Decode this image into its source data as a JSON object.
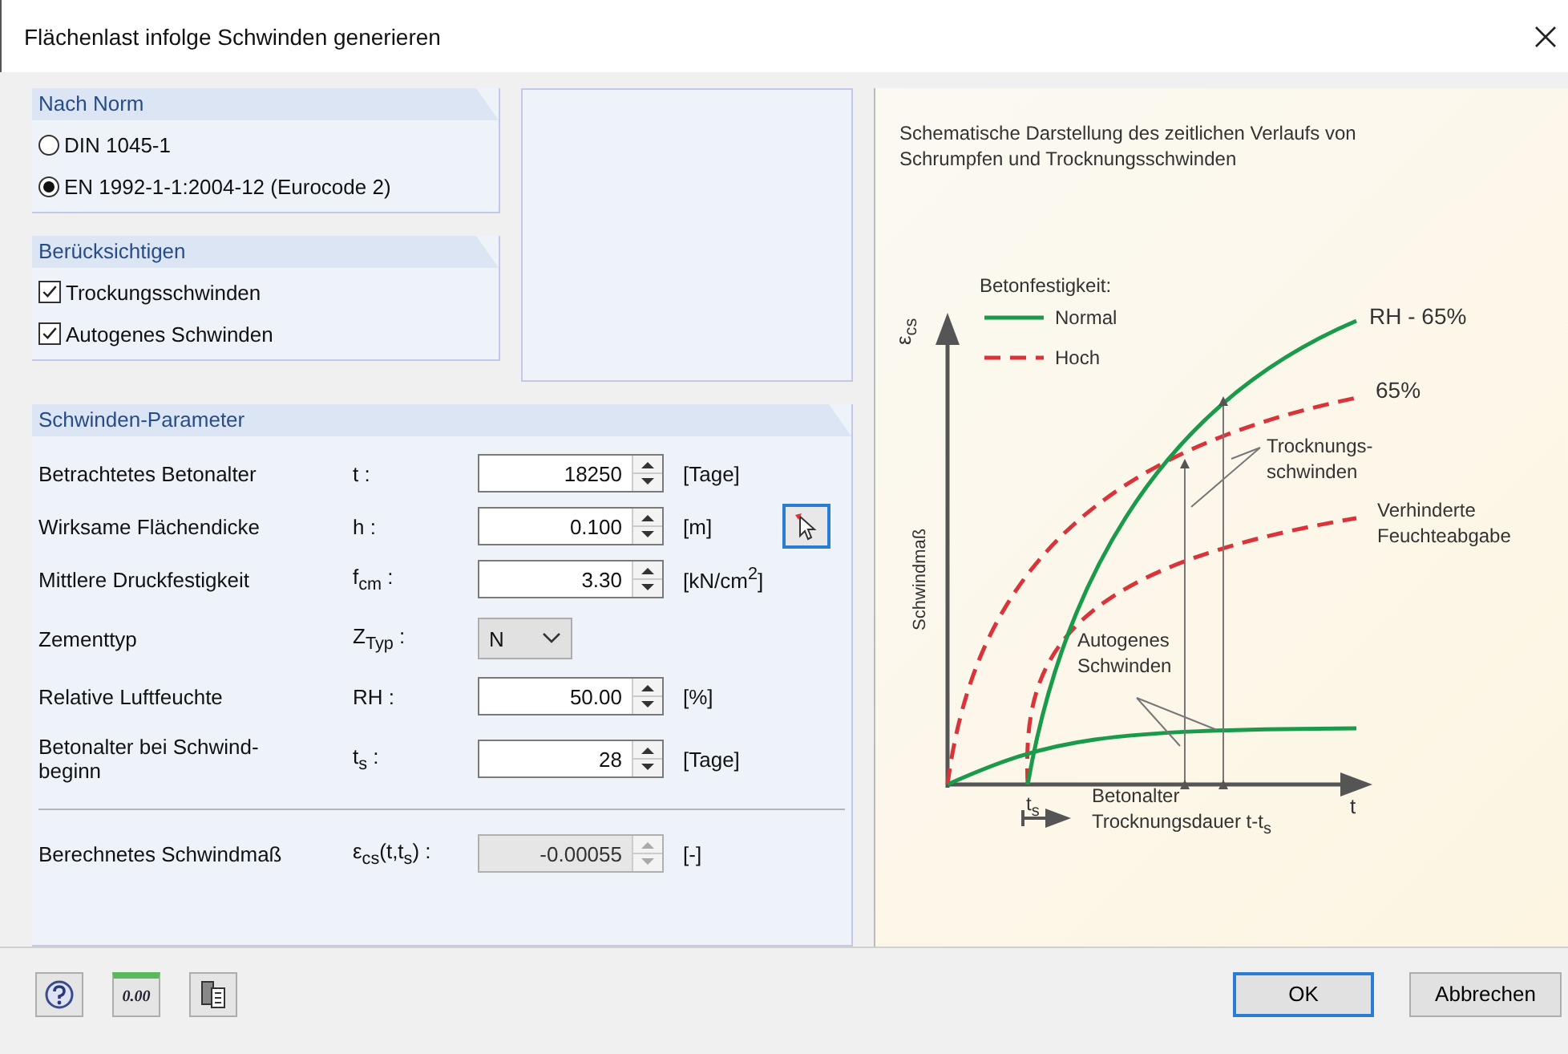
{
  "window": {
    "title": "Flächenlast infolge Schwinden generieren"
  },
  "norm": {
    "title": "Nach Norm",
    "options": [
      {
        "label": "DIN 1045-1",
        "selected": false
      },
      {
        "label": "EN 1992-1-1:2004-12 (Eurocode 2)",
        "selected": true
      }
    ]
  },
  "consider": {
    "title": "Berücksichtigen",
    "options": [
      {
        "label": "Trockungsschwinden",
        "checked": true
      },
      {
        "label": "Autogenes Schwinden",
        "checked": true
      }
    ]
  },
  "parameters": {
    "title": "Schwinden-Parameter",
    "rows": [
      {
        "kind": "spin",
        "label": "Betrachtetes Betonalter",
        "symbol": "t :",
        "value": "18250",
        "unit": "[Tage]",
        "picker": false
      },
      {
        "kind": "spin",
        "label": "Wirksame Flächendicke",
        "symbol": "h :",
        "value": "0.100",
        "unit": "[m]",
        "picker": true
      },
      {
        "kind": "spin",
        "label": "Mittlere Druckfestigkeit",
        "symbol": "f$_{cm}$ :",
        "value": "3.30",
        "unit": "[kN/cm$^{2}$]",
        "picker": false
      },
      {
        "kind": "select",
        "label": "Zementtyp",
        "symbol": "Z$_{Typ}$ :",
        "value": "N",
        "picker": false
      },
      {
        "kind": "spin",
        "label": "Relative Luftfeuchte",
        "symbol": "RH :",
        "value": "50.00",
        "unit": "[%]",
        "picker": false
      },
      {
        "kind": "spin",
        "label": "Betonalter bei Schwind-beginn",
        "symbol": "t$_{s}$ :",
        "value": "28",
        "unit": "[Tage]",
        "picker": false
      },
      {
        "kind": "result",
        "label": "Berechnetes Schwindmaß",
        "symbol": "ε$_{cs}$(t,t$_{s}$) :",
        "value": "-0.00055",
        "unit": "[-]",
        "picker": false
      }
    ]
  },
  "diagram": {
    "title": "Schematische Darstellung des zeitlichen Verlaufs von Schrumpfen und Trocknungsschwinden",
    "legend_title": "Betonfestigkeit:",
    "legend": [
      {
        "kind": "solid",
        "label": "Normal"
      },
      {
        "kind": "dashed",
        "label": "Hoch"
      }
    ],
    "labels": [
      {
        "kind": "rh",
        "text": "RH - 65%"
      },
      {
        "kind": "pct",
        "text": "65%"
      },
      {
        "kind": "drying",
        "text": "Trocknungs-schwinden"
      },
      {
        "kind": "moisture",
        "text": "Verhinderte Feuchteabgabe"
      },
      {
        "kind": "autogenous",
        "text": "Autogenes Schwinden"
      }
    ],
    "y_symbol": "ε$_{cs}$",
    "y_label": "Schwindmaß",
    "x_tick": "t$_{s}$",
    "x_label": "t",
    "note": [
      "Betonalter",
      "Trocknungsdauer t-t$_{s}$"
    ]
  },
  "footer": {
    "tools": [
      {
        "kind": "help"
      },
      {
        "kind": "decimals",
        "text": "0.00"
      },
      {
        "kind": "export"
      }
    ],
    "buttons": [
      {
        "label": "OK",
        "default": true
      },
      {
        "label": "Abbrechen",
        "default": false
      }
    ]
  }
}
